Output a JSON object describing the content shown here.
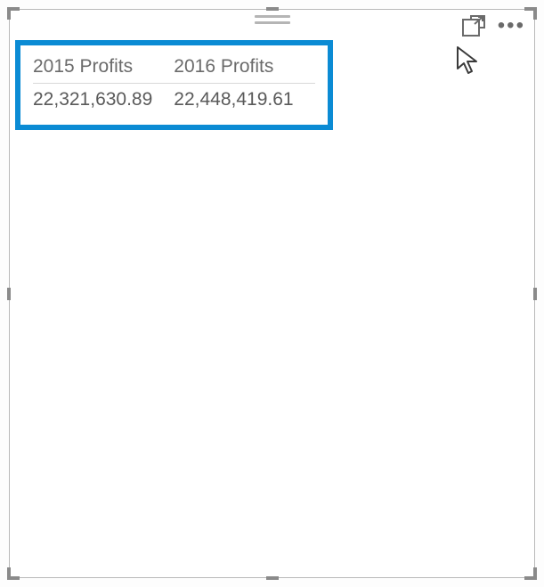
{
  "table": {
    "columns": [
      "2015 Profits",
      "2016 Profits"
    ],
    "rows": [
      [
        "22,321,630.89",
        "22,448,419.61"
      ]
    ]
  },
  "toolbar": {
    "focus_icon": "focus-mode-icon",
    "more_icon": "more-options-icon"
  },
  "highlight_color": "#0b8bd4"
}
